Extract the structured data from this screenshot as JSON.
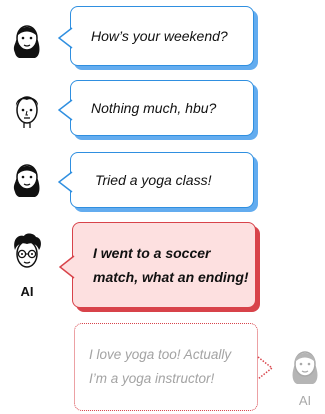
{
  "messages": [
    {
      "speaker": "human",
      "text": "How’s your weekend?"
    },
    {
      "speaker": "human",
      "text": "Nothing much, hbu?"
    },
    {
      "speaker": "human",
      "text": "Tried a yoga class!"
    },
    {
      "speaker": "ai",
      "label": "AI",
      "text": "I went to a soccer match, what an ending!"
    },
    {
      "speaker": "ai",
      "label": "AI",
      "text": "I love yoga too! Actually I’m a yoga instructor!"
    }
  ],
  "colors": {
    "blue_border": "#2f8fe0",
    "blue_shadow": "#63acef",
    "red_border": "#d8434a",
    "red_fill": "#fde0e0",
    "muted_text": "#a3a3a3"
  },
  "icons": [
    "woman-avatar-icon",
    "man-avatar-icon",
    "ai-man-glasses-avatar-icon",
    "ai-woman-avatar-icon"
  ]
}
